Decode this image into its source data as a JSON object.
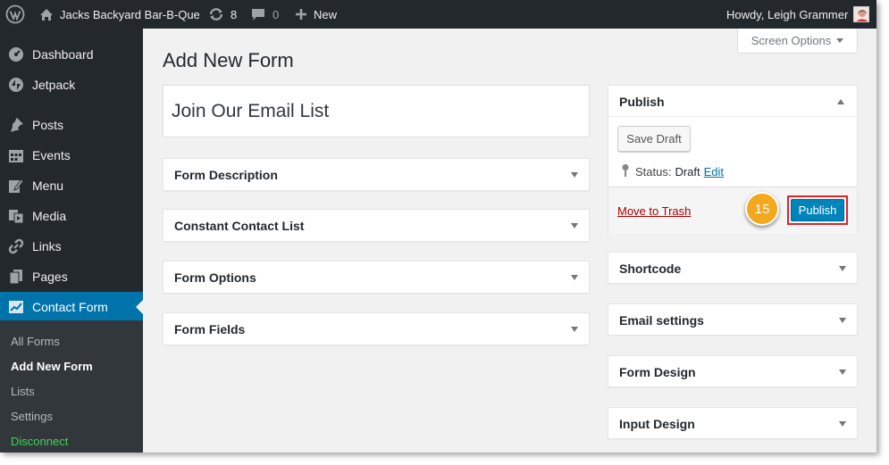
{
  "adminbar": {
    "site_name": "Jacks Backyard Bar-B-Que",
    "updates_count": "8",
    "comments_count": "0",
    "new_label": "New",
    "greeting": "Howdy, Leigh Grammer"
  },
  "sidebar": {
    "items": [
      {
        "label": "Dashboard",
        "icon": "dashboard-icon"
      },
      {
        "label": "Jetpack",
        "icon": "jetpack-icon"
      },
      {
        "label": "Posts",
        "icon": "pin-icon"
      },
      {
        "label": "Events",
        "icon": "calendar-icon"
      },
      {
        "label": "Menu",
        "icon": "edit-icon"
      },
      {
        "label": "Media",
        "icon": "media-icon"
      },
      {
        "label": "Links",
        "icon": "link-icon"
      },
      {
        "label": "Pages",
        "icon": "pages-icon"
      },
      {
        "label": "Contact Form",
        "icon": "chart-icon"
      }
    ],
    "submenu": [
      "All Forms",
      "Add New Form",
      "Lists",
      "Settings",
      "Disconnect"
    ]
  },
  "screen_options_label": "Screen Options",
  "page_title": "Add New Form",
  "form_title_value": "Join Our Email List",
  "left_boxes": [
    "Form Description",
    "Constant Contact List",
    "Form Options",
    "Form Fields"
  ],
  "publish": {
    "title": "Publish",
    "save_draft": "Save Draft",
    "status_label": "Status:",
    "status_value": "Draft",
    "edit_link": "Edit",
    "trash_link": "Move to Trash",
    "publish_button": "Publish"
  },
  "right_boxes": [
    "Shortcode",
    "Email settings",
    "Form Design",
    "Input Design"
  ],
  "step_badge": "15",
  "colors": {
    "admin_bg": "#23282d",
    "accent": "#0073aa",
    "publish_btn": "#0085ba",
    "highlight_border": "#d9262d",
    "badge": "#f4a81d",
    "disconnect": "#46d05a"
  }
}
